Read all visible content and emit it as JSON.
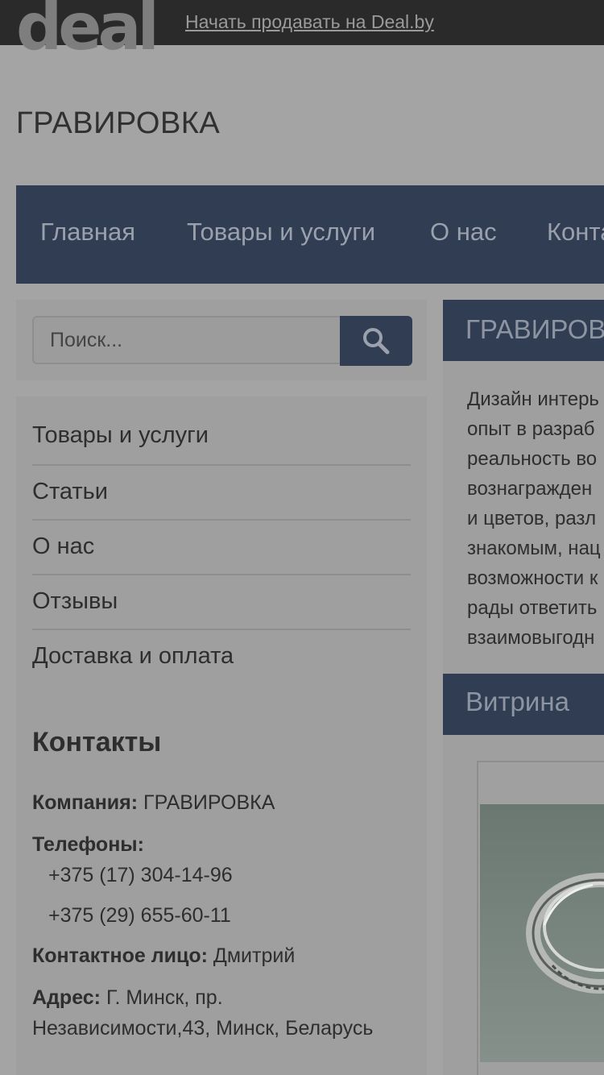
{
  "topbar": {
    "logo": "deal",
    "sell_link": "Начать продавать на Deal.by"
  },
  "site": {
    "title": "ГРАВИРОВКА"
  },
  "nav": {
    "items": [
      {
        "label": "Главная"
      },
      {
        "label": "Товары и услуги"
      },
      {
        "label": "О нас"
      },
      {
        "label": "Конта"
      }
    ]
  },
  "search": {
    "placeholder": "Поиск..."
  },
  "sidebar": {
    "items": [
      {
        "label": "Товары и услуги"
      },
      {
        "label": "Статьи"
      },
      {
        "label": "О нас"
      },
      {
        "label": "Отзывы"
      },
      {
        "label": "Доставка и оплата"
      }
    ]
  },
  "contacts": {
    "title": "Контакты",
    "company_label": "Компания:",
    "company_value": "ГРАВИРОВКА",
    "phones_label": "Телефоны:",
    "phones": [
      "+375 (17) 304-14-96",
      "+375 (29) 655-60-11"
    ],
    "person_label": "Контактное лицо:",
    "person_value": "Дмитрий",
    "address_label": "Адрес:",
    "address_line1": "Г. Минск, пр.",
    "address_line2": "Независимости,43, Минск, Беларусь"
  },
  "main": {
    "header": "ГРАВИРОВ",
    "description_lines": [
      "Дизайн интерь",
      "опыт в разраб",
      "реальность во",
      "вознагражден",
      "и цветов, разл",
      "знакомым, нац",
      "возможности к",
      "рады ответить",
      "взаимовыгодн"
    ]
  },
  "vitrina": {
    "header": "Витрина"
  },
  "colors": {
    "nav_bg": "#303d52",
    "topbar_bg": "#2a2a2a",
    "panel_bg": "#9f9f9f"
  }
}
